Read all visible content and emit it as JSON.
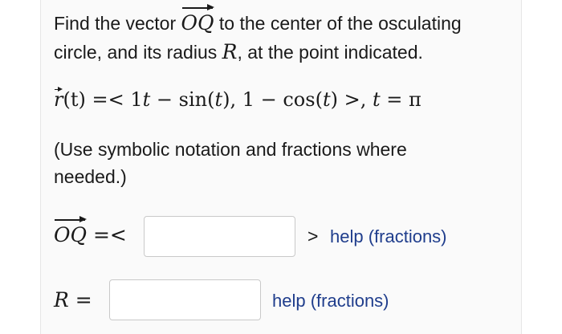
{
  "prompt": {
    "line1_before": "Find the vector ",
    "line1_vector": "OQ",
    "line1_after": " to the center of the osculating",
    "line2_before": "circle, and its radius ",
    "line2_var": "R",
    "line2_after": ", at the point indicated."
  },
  "equation": {
    "func": "r",
    "arg": "(t) =< 1",
    "t1": "t",
    "mid": " − sin(",
    "t2": "t",
    "mid2": "),  1 − cos(",
    "t3": "t",
    "end": ") >, ",
    "t4": "t",
    "eqpi": " = π"
  },
  "note": {
    "line1": "(Use symbolic notation and fractions where",
    "line2": "needed.)"
  },
  "oq_row": {
    "vector": "OQ",
    "eq": " =<",
    "input_value": "",
    "close": ">",
    "help": "help (fractions)"
  },
  "r_row": {
    "var": "R",
    "eq": " =",
    "input_value": "",
    "help": "help (fractions)"
  }
}
